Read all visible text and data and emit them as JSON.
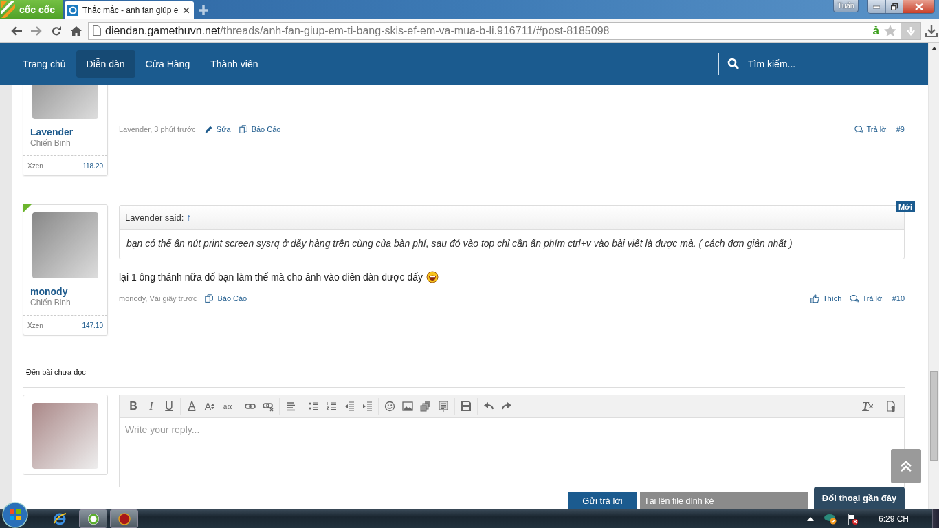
{
  "browser": {
    "logo": "cốc cốc",
    "tab_title": "Thắc mắc - anh fan giúp e",
    "profile": "Tuấn",
    "url_host": "diendan.gamethuvn.net",
    "url_path": "/threads/anh-fan-giup-em-ti-bang-skis-ef-em-va-mua-b-li.916711/#post-8185098",
    "extension_badge": "ả"
  },
  "nav": {
    "items": [
      {
        "label": "Trang chủ",
        "selected": false
      },
      {
        "label": "Diễn đàn",
        "selected": true
      },
      {
        "label": "Cửa Hàng",
        "selected": false
      },
      {
        "label": "Thành viên",
        "selected": false
      }
    ],
    "search": "Tìm kiếm..."
  },
  "posts": [
    {
      "author": "Lavender",
      "rank": "Chiến Binh",
      "stat_label": "Xzen",
      "stat_value": "118.20",
      "byline": "Lavender, 3 phút trước",
      "actions": [
        {
          "kind": "edit",
          "label": "Sửa"
        },
        {
          "kind": "report",
          "label": "Báo Cáo"
        }
      ],
      "right_actions": [
        {
          "kind": "reply",
          "label": "Trả lời"
        }
      ],
      "number": "#9"
    },
    {
      "author": "monody",
      "rank": "Chiến Binh",
      "stat_label": "Xzen",
      "stat_value": "147.10",
      "is_new": true,
      "badge": "Mới",
      "quote": {
        "author": "Lavender said:",
        "jump": "↑",
        "text": "bạn có thể ấn nút print screen sysrq ở dãy hàng trên cùng của bàn phí, sau đó vào top chỉ cần ấn phím ctrl+v vào bài viết là được mà. ( cách đơn giản nhất )"
      },
      "message": "lại 1 ông thánh nữa đố bạn làm thế mà cho ảnh vào diễn đàn được đấy",
      "byline": "monody, Vài giây trước",
      "actions": [
        {
          "kind": "report",
          "label": "Báo Cáo"
        }
      ],
      "right_actions": [
        {
          "kind": "like",
          "label": "Thích"
        },
        {
          "kind": "reply",
          "label": "Trả lời"
        }
      ],
      "number": "#10"
    }
  ],
  "unread_link": "Đến bài chưa đọc",
  "editor": {
    "toolbar_left": [
      [
        {
          "kind": "bold",
          "label": "B"
        },
        {
          "kind": "italic",
          "label": "I"
        },
        {
          "kind": "underline",
          "label": "U"
        }
      ],
      [
        {
          "kind": "font-color",
          "label": "A"
        },
        {
          "kind": "font-size",
          "label": "A"
        },
        {
          "kind": "smallcaps",
          "label": "aα"
        }
      ],
      [
        {
          "kind": "link"
        },
        {
          "kind": "unlink"
        }
      ],
      [
        {
          "kind": "align"
        }
      ],
      [
        {
          "kind": "bullets"
        },
        {
          "kind": "numbers"
        },
        {
          "kind": "outdent"
        },
        {
          "kind": "indent"
        }
      ],
      [
        {
          "kind": "smiley"
        },
        {
          "kind": "image"
        },
        {
          "kind": "media"
        },
        {
          "kind": "template"
        }
      ],
      [
        {
          "kind": "save"
        }
      ],
      [
        {
          "kind": "undo"
        },
        {
          "kind": "redo"
        }
      ]
    ],
    "toolbar_right": [
      {
        "kind": "remove-format",
        "label": "T"
      },
      {
        "kind": "settings"
      }
    ],
    "placeholder": "Write your reply...",
    "buttons": [
      {
        "kind": "primary",
        "label": "Gửi trả lời"
      },
      {
        "kind": "secondary",
        "label": "Tài lên file đính kè"
      }
    ]
  },
  "chat": "Đối thoại gần đây",
  "taskbar": {
    "clock": "6:29 CH"
  }
}
